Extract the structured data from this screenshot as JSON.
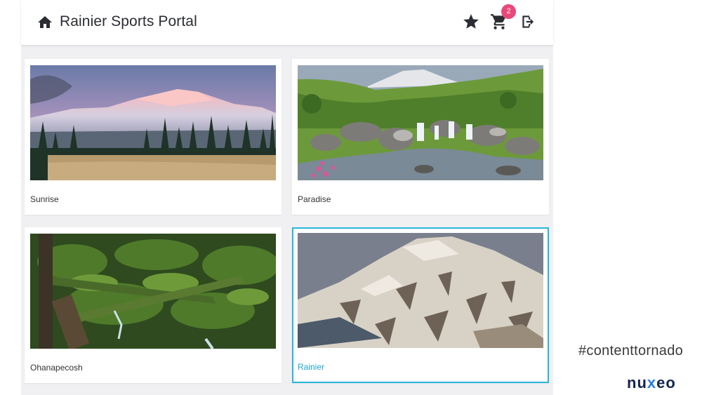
{
  "header": {
    "title": "Rainier Sports Portal",
    "cart_count": "2",
    "icons": [
      "home-icon",
      "star-icon",
      "cart-icon",
      "logout-icon"
    ]
  },
  "gallery": {
    "cards": [
      {
        "label": "Sunrise",
        "selected": false
      },
      {
        "label": "Paradise",
        "selected": false
      },
      {
        "label": "Ohanapecosh",
        "selected": false
      },
      {
        "label": "Rainier",
        "selected": true
      }
    ]
  },
  "footer": {
    "hashtag": "#contenttornado",
    "brand": "nuxeo"
  },
  "colors": {
    "accent": "#29b6d9",
    "badge": "#e8487a",
    "brand": "#14244f"
  }
}
